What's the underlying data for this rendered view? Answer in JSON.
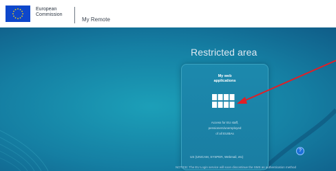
{
  "header": {
    "brand_line1": "European",
    "brand_line2": "Commission",
    "app_title": "My Remote",
    "logo_icon": "eu-flag-icon"
  },
  "main": {
    "heading": "Restricted area",
    "card": {
      "title_line1": "My web",
      "title_line2": "applications",
      "icon": "apps-grid-icon",
      "desc_line1": "Access for EU staff,",
      "desc_line2": "pensioners/unemployed",
      "desc_line3": "of all EUIBAs"
    },
    "systems_text": "US (UNICAM, SYSPER, Webmail, etc)",
    "notice_text": "NOTICE: The EU Login service will soon discontinue the SMS as authentication method",
    "help_label": "?"
  },
  "colors": {
    "accent_blue": "#0e47cb",
    "annotation_red": "#e01f26"
  }
}
